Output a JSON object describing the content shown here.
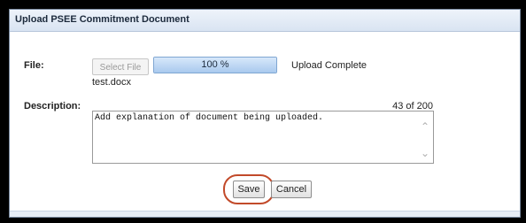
{
  "dialog": {
    "title": "Upload PSEE Commitment Document",
    "file_label": "File:",
    "select_file_label": "Select File",
    "progress": {
      "text": "100 %",
      "fraction": 1.0
    },
    "status_text": "Upload Complete",
    "file_name": "test.docx",
    "description_label": "Description:",
    "char_counter": "43 of 200",
    "description_value": "Add explanation of document being uploaded.",
    "save_label": "Save",
    "cancel_label": "Cancel",
    "icons": {
      "scroll_up": "chevron-up-icon",
      "scroll_down": "chevron-down-icon"
    },
    "colors": {
      "highlight": "#c24a2a",
      "progress_fill": "#a9c9ee"
    }
  }
}
